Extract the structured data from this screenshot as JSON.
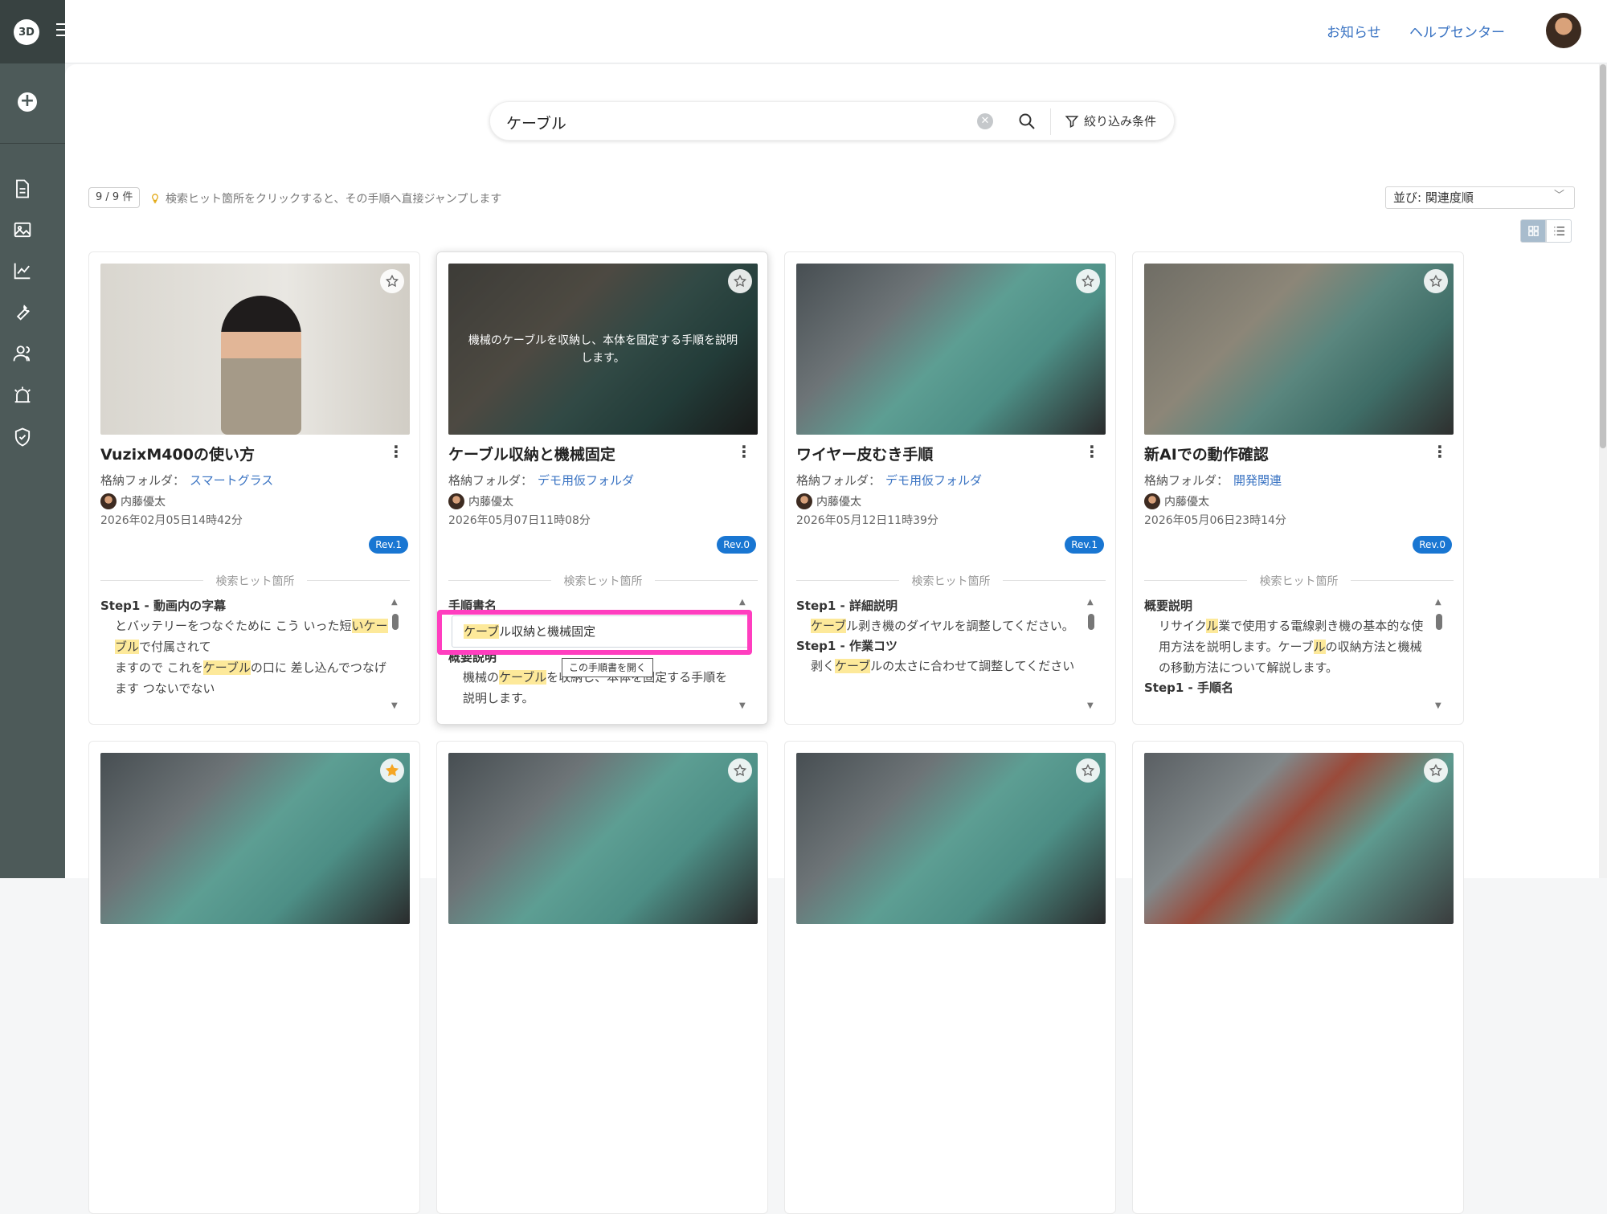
{
  "sidebar": {
    "logo_text": "3D",
    "menu_icon": "hamburger-icon",
    "add_icon": "plus-icon",
    "items": [
      {
        "name": "document-icon"
      },
      {
        "name": "image-icon"
      },
      {
        "name": "chart-icon"
      },
      {
        "name": "wrench-icon"
      },
      {
        "name": "users-icon"
      },
      {
        "name": "alarm-icon"
      },
      {
        "name": "shield-check-icon"
      }
    ]
  },
  "header": {
    "notice": "お知らせ",
    "help": "ヘルプセンター"
  },
  "search": {
    "value": "ケーブル",
    "clear_icon": "clear-icon",
    "search_icon": "search-icon",
    "filter_label": "絞り込み条件"
  },
  "results": {
    "count": "9 / 9 件",
    "hint": "検索ヒット箇所をクリックすると、その手順へ直接ジャンプします",
    "sort_label": "並び: 関連度順"
  },
  "common": {
    "folder_prefix": "格納フォルダ：",
    "hits_label": "検索ヒット箇所"
  },
  "cards": [
    {
      "title": "VuzixM400の使い方",
      "folder": "スマートグラス",
      "author": "内藤優太",
      "date": "2026年02月05日14時42分",
      "rev": "Rev.1",
      "hits": {
        "h1": "Step1 - 動画内の字幕",
        "t1a": "とバッテリーをつなぐために こう いった短",
        "t1b": "いケーブル",
        "t1c": "で付属されて",
        "t2a": "ますので これを",
        "t2b": "ケーブル",
        "t2c": "の口に 差し込んでつなげます つないでない"
      }
    },
    {
      "title": "ケーブル収納と機械固定",
      "overlay": "機械のケーブルを収納し、本体を固定する手順を説明します。",
      "folder": "デモ用仮フォルダ",
      "author": "内藤優太",
      "date": "2026年05月07日11時08分",
      "rev": "Rev.0",
      "hits": {
        "h1": "手順書名",
        "h2": "概要説明",
        "t2a": "機械の",
        "t2b": "ケーブル",
        "t2c": "を収納し、本体を固定する手順を説明します。"
      },
      "popup": {
        "hl": "ケーブ",
        "rest": "ル収納と機械固定"
      },
      "tooltip": "この手順書を開く"
    },
    {
      "title": "ワイヤー皮むき手順",
      "folder": "デモ用仮フォルダ",
      "author": "内藤優太",
      "date": "2026年05月12日11時39分",
      "rev": "Rev.1",
      "hits": {
        "h1": "Step1 - 詳細説明",
        "t1a": "",
        "t1b": "ケーブ",
        "t1c": "ル剥き機のダイヤルを調整してください。",
        "h2": "Step1 - 作業コツ",
        "t2a": "剥く",
        "t2b": "ケーブ",
        "t2c": "ルの太さに合わせて調整してください"
      }
    },
    {
      "title": "新AIでの動作確認",
      "folder": "開発関連",
      "author": "内藤優太",
      "date": "2026年05月06日23時14分",
      "rev": "Rev.0",
      "hits": {
        "h1": "概要説明",
        "t1a": "リサイク",
        "t1b": "ル",
        "t1c": "業で使用する電線剥き機の基本的な使用方法を説明します。ケーブ",
        "t1d": "ル",
        "t1e": "の収納方法と機械の移動方法について解説します。",
        "h2": "Step1 - 手順名"
      }
    }
  ]
}
